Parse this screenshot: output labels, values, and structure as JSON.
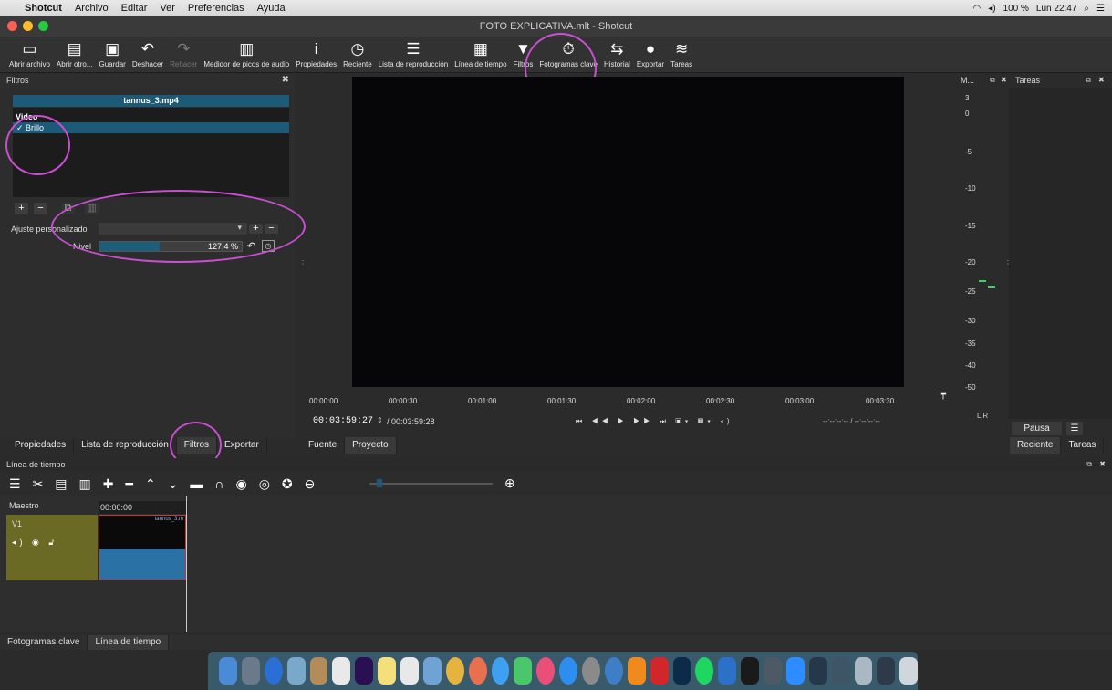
{
  "menubar": {
    "apple": "",
    "app": "Shotcut",
    "items": [
      "Archivo",
      "Editar",
      "Ver",
      "Preferencias",
      "Ayuda"
    ],
    "status_battery": "100 %",
    "status_clock": "Lun 22:47"
  },
  "window": {
    "title": "FOTO EXPLICATIVA.mlt - Shotcut"
  },
  "toolbar": {
    "items": [
      {
        "icon": "▭",
        "label": "Abrir archivo"
      },
      {
        "icon": "▤",
        "label": "Abrir otro..."
      },
      {
        "icon": "▣",
        "label": "Guardar"
      },
      {
        "icon": "↶",
        "label": "Deshacer"
      },
      {
        "icon": "↷",
        "label": "Rehacer"
      },
      {
        "icon": "▥",
        "label": "Medidor de picos de audio"
      },
      {
        "icon": "i",
        "label": "Propiedades"
      },
      {
        "icon": "◷",
        "label": "Reciente"
      },
      {
        "icon": "☰",
        "label": "Lista de reproducción"
      },
      {
        "icon": "▦",
        "label": "Línea de tiempo"
      },
      {
        "icon": "▼",
        "label": "Filtros"
      },
      {
        "icon": "⏱",
        "label": "Fotogramas clave"
      },
      {
        "icon": "⇆",
        "label": "Historial"
      },
      {
        "icon": "●",
        "label": "Exportar"
      },
      {
        "icon": "≋",
        "label": "Tareas"
      }
    ]
  },
  "filters_panel": {
    "title": "Filtros",
    "file": "tannus_3.mp4",
    "group": "Video",
    "selected_filter": "✓ Brillo",
    "preset_label": "Ajuste personalizado",
    "level_label": "Nivel",
    "level_value": "127,4 %",
    "level_fraction": 0.42
  },
  "player": {
    "ticks": [
      "00:00:00",
      "00:00:30",
      "00:01:00",
      "00:01:30",
      "00:02:00",
      "00:02:30",
      "00:03:00",
      "00:03:30"
    ],
    "timecode": "00:03:59:27",
    "duration": "/ 00:03:59:28",
    "in_out": "--:--:--:-- /      --:--:--:--",
    "tabs": [
      "Fuente",
      "Proyecto"
    ]
  },
  "meter": {
    "title": "M...",
    "labels": [
      "3",
      "0",
      "-5",
      "-10",
      "-15",
      "-20",
      "-25",
      "-30",
      "-35",
      "-40",
      "-50"
    ],
    "channels": "L  R"
  },
  "jobs": {
    "title": "Tareas",
    "pause": "Pausa",
    "tabs": [
      "Reciente",
      "Tareas"
    ]
  },
  "left_tabs": [
    "Propiedades",
    "Lista de reproducción",
    "Filtros",
    "Exportar"
  ],
  "timeline": {
    "title": "Línea de tiempo",
    "master": "Maestro",
    "time": "00:00:00",
    "track": "V1",
    "clip": "tannus_3.m"
  },
  "bottom_tabs": [
    "Fotogramas clave",
    "Línea de tiempo"
  ]
}
